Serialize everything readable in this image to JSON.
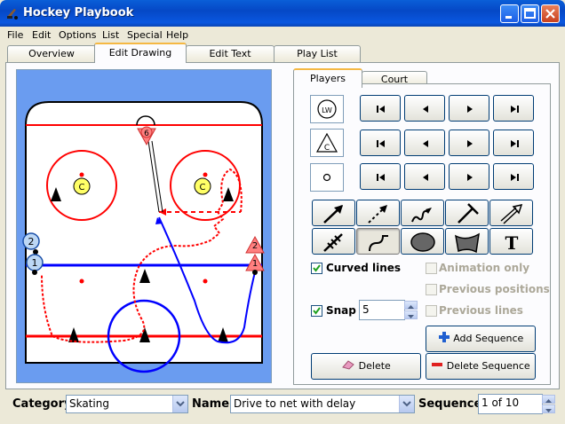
{
  "window": {
    "title": "Hockey Playbook"
  },
  "menu": [
    "File",
    "Edit",
    "Options",
    "List",
    "Special",
    "Help"
  ],
  "tabs": [
    "Overview",
    "Edit Drawing",
    "Edit Text",
    "Play List"
  ],
  "subtabs": [
    "Players",
    "Court"
  ],
  "symbols": {
    "lw_label": "LW",
    "c_label": "C"
  },
  "rink": {
    "player_labels": [
      "2",
      "1",
      "C",
      "C",
      "6"
    ],
    "cone_labels": [
      "2",
      "1"
    ]
  },
  "options": {
    "curved_lines": "Curved lines",
    "snap": "Snap",
    "snap_value": "5",
    "animation_only": "Animation only",
    "previous_positions": "Previous positions",
    "previous_lines": "Previous lines"
  },
  "buttons": {
    "add_sequence": "Add Sequence",
    "delete": "Delete",
    "delete_sequence": "Delete Sequence"
  },
  "bottom": {
    "category_label": "Category",
    "category_value": "Skating",
    "name_label": "Name",
    "name_value": "Drive to net with delay",
    "sequence_label": "Sequence",
    "sequence_value": "1 of 10"
  },
  "colors": {
    "rink_red": "#ff0000",
    "rink_blue": "#0000ff",
    "title_blue": "#0a5fd8"
  }
}
